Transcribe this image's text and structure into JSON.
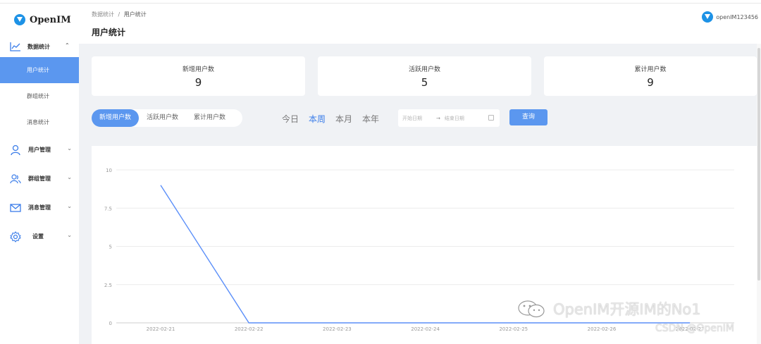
{
  "app": {
    "name": "OpenIM"
  },
  "user": {
    "name": "openIM123456"
  },
  "breadcrumb": {
    "parent": "数据统计",
    "separator": "/",
    "current": "用户统计"
  },
  "page_title": "用户统计",
  "sidebar": {
    "data_stats": {
      "label": "数据统计",
      "children": [
        "用户统计",
        "群组统计",
        "消息统计"
      ]
    },
    "items": [
      {
        "label": "用户管理",
        "icon": "user-icon"
      },
      {
        "label": "群组管理",
        "icon": "group-icon"
      },
      {
        "label": "消息管理",
        "icon": "mail-icon"
      },
      {
        "label": "设置",
        "icon": "gear-icon"
      }
    ]
  },
  "stats": [
    {
      "label": "新增用户数",
      "value": "9"
    },
    {
      "label": "活跃用户数",
      "value": "5"
    },
    {
      "label": "累计用户数",
      "value": "9"
    }
  ],
  "filter": {
    "tabs": [
      "新增用户数",
      "活跃用户数",
      "累计用户数"
    ],
    "active_tab": 0,
    "ranges": [
      "今日",
      "本周",
      "本月",
      "本年"
    ],
    "active_range": 1,
    "start_placeholder": "开始日期",
    "end_placeholder": "结束日期",
    "arrow": "→",
    "query_label": "查询"
  },
  "colors": {
    "accent": "#5b97ef",
    "line": "#5b8ff9"
  },
  "chart_data": {
    "type": "line",
    "x": [
      "2022-02-21",
      "2022-02-22",
      "2022-02-23",
      "2022-02-24",
      "2022-02-25",
      "2022-02-26",
      "2022-02-27"
    ],
    "series": [
      {
        "values": [
          9,
          0,
          0,
          0,
          0,
          0,
          0
        ]
      }
    ],
    "y_ticks": [
      0,
      2.5,
      5,
      7.5,
      10
    ],
    "ylim": [
      0,
      10
    ],
    "grid": true
  },
  "watermarks": {
    "primary": "OpenIM开源IM的No1",
    "secondary": "CSDN @OpenIM"
  }
}
